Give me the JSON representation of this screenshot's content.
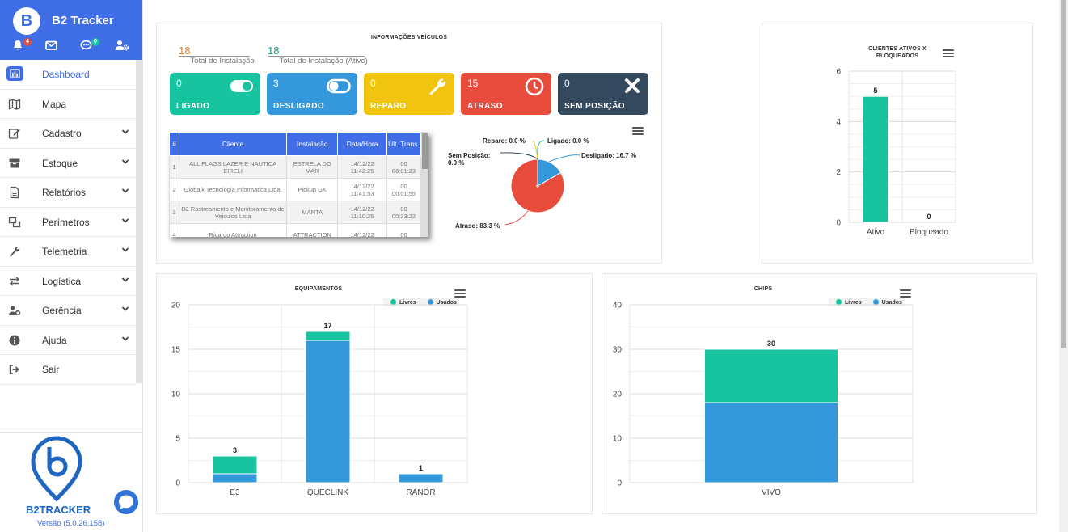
{
  "app": {
    "logo_letter": "B",
    "name": "B2 Tracker"
  },
  "header_icons": [
    {
      "icon": "bell-icon",
      "badge": "4",
      "badge_color": "#e84c3d"
    },
    {
      "icon": "envelope-icon",
      "badge": ""
    },
    {
      "icon": "chat-bubble-icon",
      "badge": "0",
      "badge_color": "#18c3a0"
    },
    {
      "icon": "user-gear-icon",
      "badge": ""
    }
  ],
  "menu": [
    {
      "label": "Dashboard",
      "icon": "chart-icon",
      "active": true,
      "expandable": false
    },
    {
      "label": "Mapa",
      "icon": "map-icon",
      "expandable": false
    },
    {
      "label": "Cadastro",
      "icon": "edit-icon",
      "expandable": true
    },
    {
      "label": "Estoque",
      "icon": "archive-icon",
      "expandable": true
    },
    {
      "label": "Relatórios",
      "icon": "file-icon",
      "expandable": true
    },
    {
      "label": "Perímetros",
      "icon": "perimeter-icon",
      "expandable": true
    },
    {
      "label": "Telemetria",
      "icon": "wrench-icon",
      "expandable": true
    },
    {
      "label": "Logística",
      "icon": "exchange-icon",
      "expandable": true
    },
    {
      "label": "Gerência",
      "icon": "users-gear-icon",
      "expandable": true
    },
    {
      "label": "Ajuda",
      "icon": "info-icon",
      "expandable": true
    },
    {
      "label": "Sair",
      "icon": "sign-out-icon",
      "expandable": false
    }
  ],
  "footer": {
    "logo_text": "B2TRACKER",
    "version": "Versão (5.0.26.158)"
  },
  "vehicles": {
    "title": "INFORMAÇÕES VEÍCULOS",
    "total_install": {
      "value": "18",
      "label": "Total de Instalação"
    },
    "total_install_active": {
      "value": "18",
      "label": "Total de Instalação (Ativo)"
    },
    "cards": [
      {
        "value": "0",
        "label": "LIGADO",
        "color": "#18c3a0",
        "icon": "toggle-on-icon"
      },
      {
        "value": "3",
        "label": "DESLIGADO",
        "color": "#3498db",
        "icon": "toggle-off-icon"
      },
      {
        "value": "0",
        "label": "REPARO",
        "color": "#f1c40f",
        "icon": "wrench-icon"
      },
      {
        "value": "15",
        "label": "ATRASO",
        "color": "#e74c3c",
        "icon": "clock-icon"
      },
      {
        "value": "0",
        "label": "SEM POSIÇÃO",
        "color": "#34495e",
        "icon": "times-icon"
      }
    ],
    "table": {
      "headers": [
        "#",
        "Cliente",
        "Instalação",
        "Data/Hora",
        "Últ. Trans."
      ],
      "rows": [
        [
          "1",
          "ALL FLAGS LAZER E NAUTICA EIRELI",
          "ESTRELA DO MAR",
          "14/12/22 11:42:25",
          "00 00:01:23"
        ],
        [
          "2",
          "Globalk Tecnologia Informatica Ltda.",
          "Pickup GK",
          "14/12/22 11:41:53",
          "00 00:01:55"
        ],
        [
          "3",
          "B2 Rastreamento e Monitoramento de Veiculos Ltda",
          "MANTA",
          "14/12/22 11:10:25",
          "00 00:33:23"
        ],
        [
          "4",
          "Ricardo Attraction",
          "ATTRACTION",
          "14/12/22",
          "00"
        ]
      ]
    }
  },
  "chart_data": [
    {
      "type": "pie",
      "slices": [
        {
          "name": "Atraso",
          "value": 83.3,
          "label": "Atraso: 83.3 %",
          "color": "#e74c3c"
        },
        {
          "name": "Desligado",
          "value": 16.7,
          "label": "Desligado: 16.7 %",
          "color": "#3498db"
        },
        {
          "name": "Ligado",
          "value": 0.0,
          "label": "Ligado: 0.0 %",
          "color": "#18c3a0"
        },
        {
          "name": "Reparo",
          "value": 0.0,
          "label": "Reparo: 0.0 %",
          "color": "#f1c40f"
        },
        {
          "name": "Sem Posição",
          "value": 0.0,
          "label": "Sem Posição: 0.0 %",
          "color": "#34495e"
        }
      ]
    },
    {
      "type": "bar",
      "title": "CLIENTES ATIVOS X BLOQUEADOS",
      "categories": [
        "Ativo",
        "Bloqueado"
      ],
      "values": [
        5,
        0
      ],
      "ylim": [
        0,
        6
      ],
      "yticks": [
        0,
        2,
        4,
        6
      ],
      "color": "#18c3a0",
      "grid": true
    },
    {
      "type": "bar",
      "stacked": true,
      "title": "EQUIPAMENTOS",
      "categories": [
        "E3",
        "QUECLINK",
        "RANOR"
      ],
      "series": [
        {
          "name": "Usados",
          "values": [
            1,
            16,
            1
          ],
          "color": "#3498db"
        },
        {
          "name": "Livres",
          "values": [
            2,
            1,
            0
          ],
          "color": "#18c3a0"
        }
      ],
      "totals": [
        3,
        17,
        1
      ],
      "ylim": [
        0,
        20
      ],
      "yticks": [
        0,
        5,
        10,
        15,
        20
      ],
      "legend": "top-right",
      "grid": true
    },
    {
      "type": "bar",
      "stacked": true,
      "title": "CHIPS",
      "categories": [
        "VIVO"
      ],
      "series": [
        {
          "name": "Usados",
          "values": [
            18
          ],
          "color": "#3498db"
        },
        {
          "name": "Livres",
          "values": [
            12
          ],
          "color": "#18c3a0"
        }
      ],
      "totals": [
        30
      ],
      "ylim": [
        0,
        40
      ],
      "yticks": [
        0,
        10,
        20,
        30,
        40
      ],
      "legend": "top-right",
      "grid": true
    }
  ]
}
